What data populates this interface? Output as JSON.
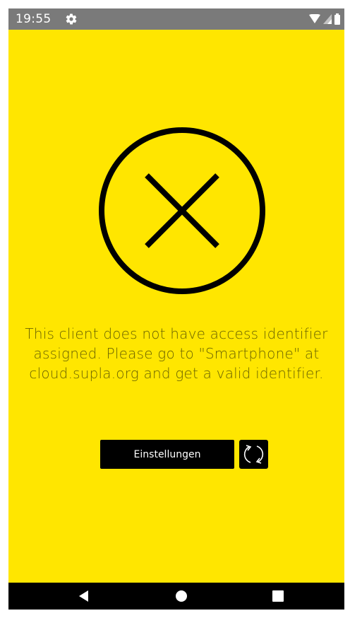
{
  "status_bar": {
    "time": "19:55",
    "settings_icon": "gear-icon",
    "wifi_icon": "wifi-icon",
    "signal_icon": "signal-icon",
    "battery_icon": "battery-icon"
  },
  "main": {
    "error_icon": "circle-x-icon",
    "message": "This client does not have access identifier assigned. Please go to \"Smartphone\" at cloud.supla.org and get a valid identifier.",
    "settings_button_label": "Einstellungen",
    "refresh_icon": "refresh-icon"
  },
  "nav_bar": {
    "back_icon": "back-triangle-icon",
    "home_icon": "home-circle-icon",
    "recents_icon": "recents-square-icon"
  },
  "colors": {
    "background": "#FFE600",
    "message_text": "#6b6400",
    "status_bar": "#7a7a7a",
    "nav_bar": "#000000",
    "button": "#000000",
    "button_text": "#ffffff"
  }
}
